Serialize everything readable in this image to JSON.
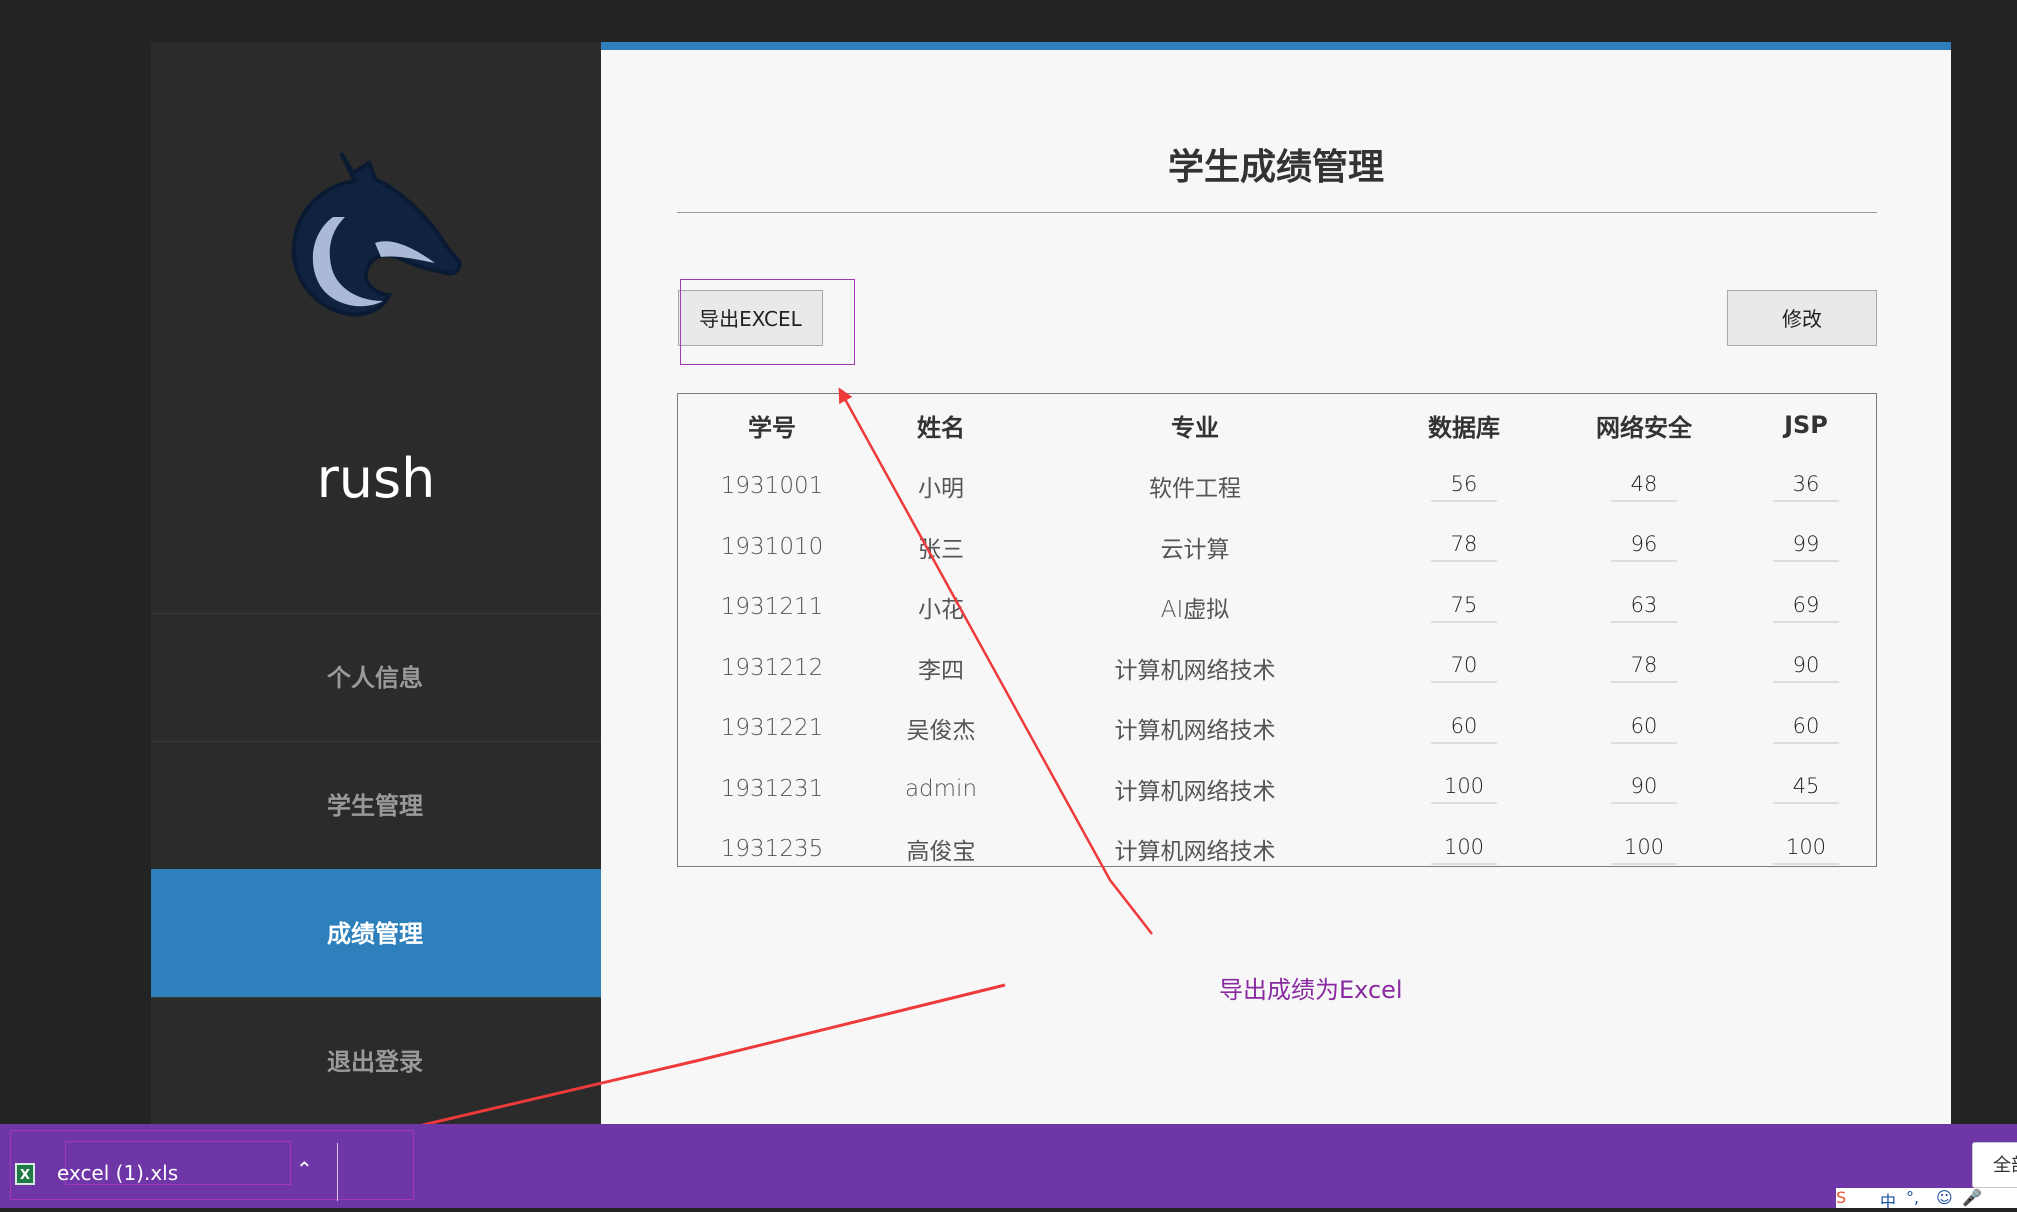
{
  "sidebar": {
    "brand": "rush",
    "nav": [
      {
        "label": "个人信息",
        "active": false
      },
      {
        "label": "学生管理",
        "active": false
      },
      {
        "label": "成绩管理",
        "active": true
      },
      {
        "label": "退出登录",
        "active": false
      }
    ]
  },
  "main": {
    "title": "学生成绩管理",
    "export_button": "导出EXCEL",
    "edit_button": "修改",
    "table": {
      "headers": [
        "学号",
        "姓名",
        "专业",
        "数据库",
        "网络安全",
        "JSP"
      ],
      "rows": [
        [
          "1931001",
          "小明",
          "软件工程",
          "56",
          "48",
          "36"
        ],
        [
          "1931010",
          "张三",
          "云计算",
          "78",
          "96",
          "99"
        ],
        [
          "1931211",
          "小花",
          "AI虚拟",
          "75",
          "63",
          "69"
        ],
        [
          "1931212",
          "李四",
          "计算机网络技术",
          "70",
          "78",
          "90"
        ],
        [
          "1931221",
          "吴俊杰",
          "计算机网络技术",
          "60",
          "60",
          "60"
        ],
        [
          "1931231",
          "admin",
          "计算机网络技术",
          "100",
          "90",
          "45"
        ],
        [
          "1931235",
          "高俊宝",
          "计算机网络技术",
          "100",
          "100",
          "100"
        ]
      ]
    }
  },
  "annotation": "导出成绩为Excel",
  "download_bar": {
    "file_name": "excel (1).xls",
    "show_all": "全部",
    "file_icon": "excel-file-icon",
    "chevron_icon": "chevron-up-icon"
  },
  "tray": {
    "ime_label": "中"
  },
  "colors": {
    "accent": "#2e80bd",
    "sidebar_bg": "#2b2b2b",
    "download_bar_bg": "#6f36a8",
    "annotation_text": "#8a2aa0",
    "arrow": "#ee3a3a"
  }
}
